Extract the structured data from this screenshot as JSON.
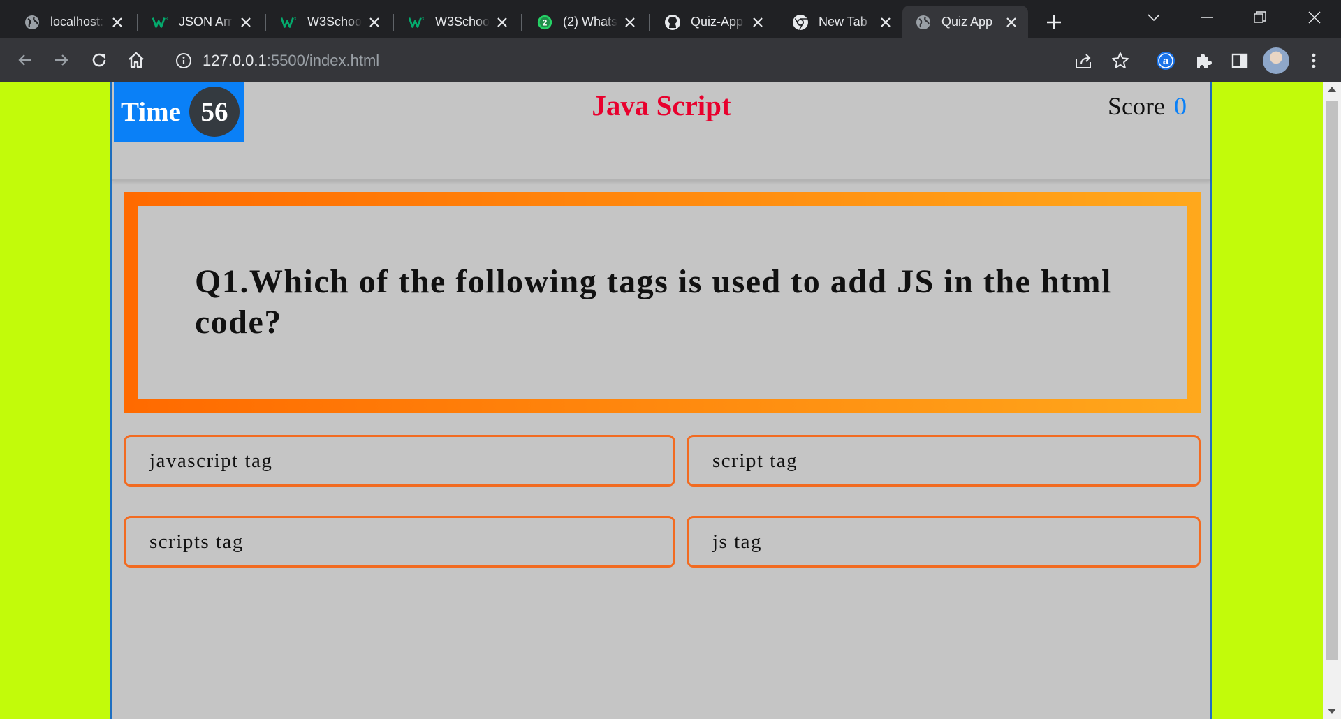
{
  "browser": {
    "tabs": [
      {
        "title": "localhost:",
        "icon": "globe-icon",
        "active": false
      },
      {
        "title": "JSON Arr",
        "icon": "w3schools-icon",
        "active": false
      },
      {
        "title": "W3Schoo",
        "icon": "w3schools-icon",
        "active": false
      },
      {
        "title": "W3Schoo",
        "icon": "w3schools-icon",
        "active": false
      },
      {
        "title": "(2) Whats",
        "icon": "whatsapp-icon",
        "active": false
      },
      {
        "title": "Quiz-App",
        "icon": "github-icon",
        "active": false
      },
      {
        "title": "New Tab",
        "icon": "chrome-icon",
        "active": false
      },
      {
        "title": "Quiz App",
        "icon": "globe-icon",
        "active": true
      }
    ],
    "whatsapp_unread": "2",
    "address": {
      "host": "127.0.0.1",
      "path": ":5500/index.html"
    },
    "extension_badge": "a"
  },
  "quiz": {
    "timer": {
      "label": "Time",
      "value": "56"
    },
    "title": "Java Script",
    "score": {
      "label": "Score",
      "value": "0"
    },
    "question": "Q1.Which of the following tags is used to add JS in the html code?",
    "options": [
      "javascript tag",
      "script tag",
      "scripts tag",
      "js tag"
    ]
  },
  "colors": {
    "page_background": "#c2fb0a",
    "card_background": "#c5c5c5",
    "timer_background": "#0a80f7",
    "title_color": "#e8002d",
    "score_value_color": "#0a80f7",
    "question_border_gradient": [
      "#ff6a00",
      "#ffa81c"
    ],
    "option_border": "#f26b21"
  }
}
